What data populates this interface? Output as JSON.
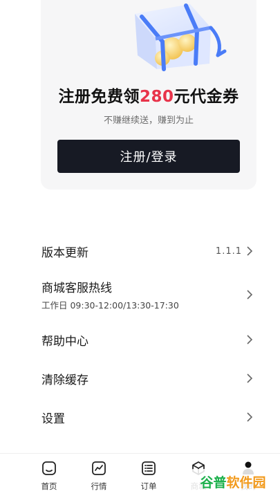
{
  "promo": {
    "title_prefix": "注册免费领",
    "title_amount": "280",
    "title_suffix": "元代金券",
    "subtitle": "不赚继续送，赚到为止",
    "button_label": "注册/登录"
  },
  "menu": {
    "version": {
      "label": "版本更新",
      "value": "1.1.1"
    },
    "hotline": {
      "label": "商城客服热线",
      "hours": "工作日 09:30-12:00/13:30-17:30"
    },
    "help": {
      "label": "帮助中心"
    },
    "cache": {
      "label": "清除缓存"
    },
    "settings": {
      "label": "设置"
    }
  },
  "tabbar": {
    "home": {
      "label": "首页",
      "icon": "home-icon"
    },
    "market": {
      "label": "行情",
      "icon": "chart-icon"
    },
    "orders": {
      "label": "订单",
      "icon": "list-icon"
    },
    "fourth": {
      "label": "商城",
      "icon": "cube-icon"
    },
    "mine": {
      "label": "我的",
      "icon": "person-icon"
    }
  },
  "watermark": {
    "part1": "谷普",
    "part2": "软件园"
  },
  "colors": {
    "accent_red": "#e8334a",
    "button_dark": "#171a24",
    "card_bg": "#f6f6f7"
  }
}
